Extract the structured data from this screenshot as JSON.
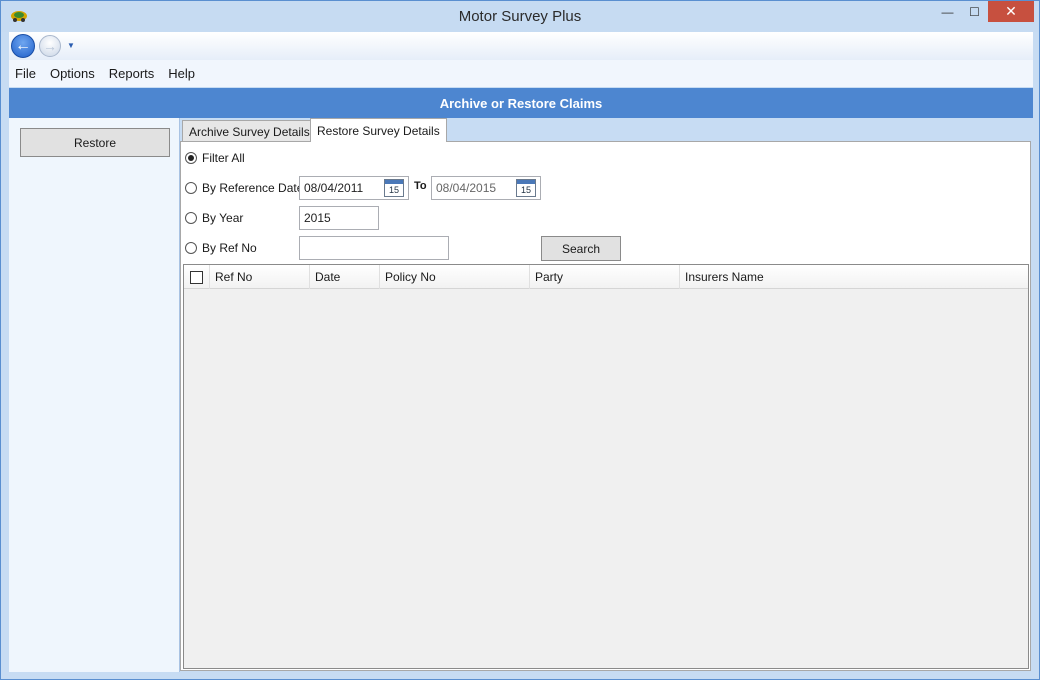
{
  "window": {
    "title": "Motor Survey Plus",
    "controls": {
      "minimize": "—",
      "maximize": "☐",
      "close": "✕"
    }
  },
  "nav": {
    "back_icon": "back-arrow-icon",
    "forward_icon": "forward-arrow-icon"
  },
  "menu": {
    "items": [
      {
        "label": "File"
      },
      {
        "label": "Options"
      },
      {
        "label": "Reports"
      },
      {
        "label": "Help"
      }
    ]
  },
  "header": {
    "title": "Archive or Restore Claims"
  },
  "sidebar": {
    "restore_label": "Restore"
  },
  "tabs": [
    {
      "label": "Archive Survey Details",
      "active": false
    },
    {
      "label": "Restore Survey Details",
      "active": true
    }
  ],
  "filters": {
    "filter_all": {
      "label": "Filter All",
      "checked": true
    },
    "by_reference_date": {
      "label": "By Reference Date",
      "checked": false,
      "from_value": "08/04/2011",
      "to_label": "To",
      "to_value": "08/04/2015",
      "calendar_day": "15"
    },
    "by_year": {
      "label": "By Year",
      "checked": false,
      "value": "2015"
    },
    "by_ref_no": {
      "label": "By Ref No",
      "checked": false,
      "value": ""
    },
    "search_label": "Search"
  },
  "grid": {
    "columns": [
      "Ref No",
      "Date",
      "Policy No",
      "Party",
      "Insurers Name"
    ],
    "rows": []
  },
  "colors": {
    "header_band": "#4d86d0",
    "close_button": "#c7503f",
    "window_frame": "#c7dcf3"
  }
}
